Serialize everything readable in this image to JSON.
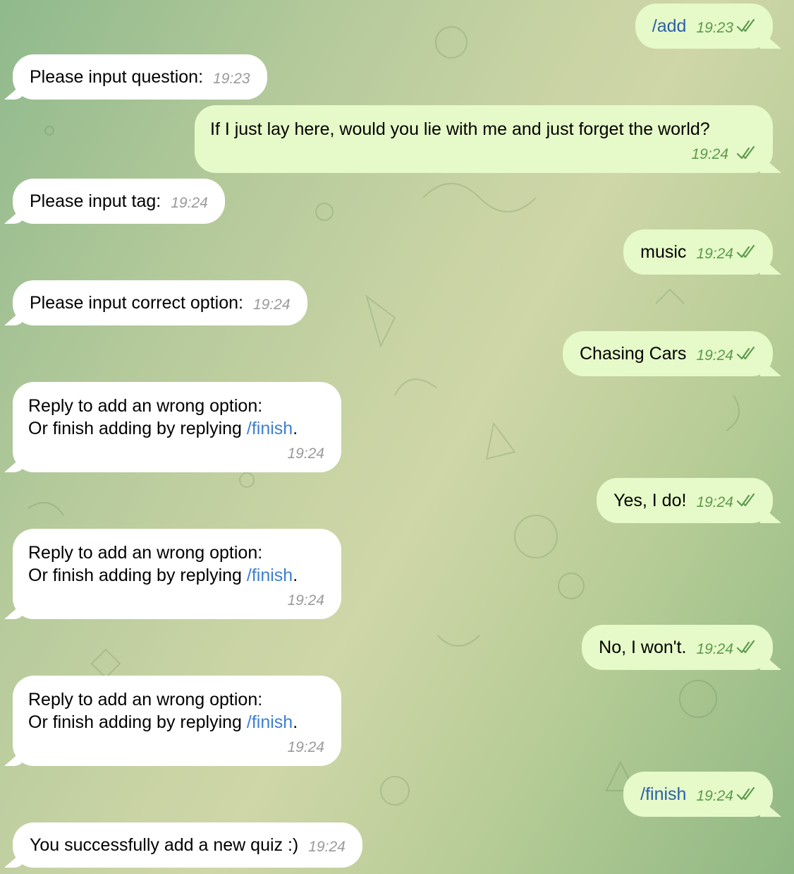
{
  "chat": {
    "messages": [
      {
        "dir": "out",
        "text": "/add",
        "time": "19:23"
      },
      {
        "dir": "in",
        "text": "Please input question:",
        "time": "19:23"
      },
      {
        "dir": "out",
        "text": "If I just lay here, would you lie with me and just forget the world?",
        "time": "19:24"
      },
      {
        "dir": "in",
        "text": "Please input tag:",
        "time": "19:24"
      },
      {
        "dir": "out",
        "text": "music",
        "time": "19:24"
      },
      {
        "dir": "in",
        "text": "Please input correct option:",
        "time": "19:24"
      },
      {
        "dir": "out",
        "text": "Chasing Cars",
        "time": "19:24"
      },
      {
        "dir": "in",
        "line1": "Reply to add an wrong option:",
        "line2_prefix": "Or finish adding by replying ",
        "line2_link": "/finish",
        "line2_suffix": ".",
        "time": "19:24"
      },
      {
        "dir": "out",
        "text": "Yes, I do!",
        "time": "19:24"
      },
      {
        "dir": "in",
        "line1": "Reply to add an wrong option:",
        "line2_prefix": "Or finish adding by replying ",
        "line2_link": "/finish",
        "line2_suffix": ".",
        "time": "19:24"
      },
      {
        "dir": "out",
        "text": "No, I won't.",
        "time": "19:24"
      },
      {
        "dir": "in",
        "line1": "Reply to add an wrong option:",
        "line2_prefix": "Or finish adding by replying ",
        "line2_link": "/finish",
        "line2_suffix": ".",
        "time": "19:24"
      },
      {
        "dir": "out",
        "text": "/finish",
        "time": "19:24"
      },
      {
        "dir": "in",
        "text": "You successfully add a new quiz :)",
        "time": "19:24"
      }
    ]
  },
  "colors": {
    "incoming_bubble": "#ffffff",
    "outgoing_bubble": "#e6f9c8",
    "link": "#3d7fd0",
    "read_check": "#5c9a4e"
  },
  "icons": {
    "read_receipt": "double-check-icon"
  }
}
